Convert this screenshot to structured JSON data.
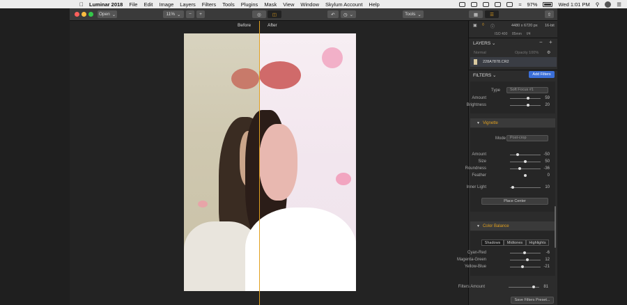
{
  "menubar": {
    "app": "Luminar 2018",
    "items": [
      "File",
      "Edit",
      "Image",
      "Layers",
      "Filters",
      "Tools",
      "Plugins",
      "Mask",
      "View",
      "Window",
      "Skylum Account",
      "Help"
    ],
    "battery": "97%",
    "clock": "Wed 1:01 PM"
  },
  "toolbar": {
    "open_label": "Open",
    "zoom_value": "11%",
    "zoom_out": "−",
    "zoom_in": "+",
    "tools_label": "Tools"
  },
  "canvas": {
    "before_label": "Before",
    "after_label": "After",
    "split_fraction": 0.437
  },
  "info": {
    "dimensions": "4480 x 6720 px",
    "bitdepth": "16-bit",
    "iso": "ISO 400",
    "focal": "85mm",
    "aperture": "f/4"
  },
  "layers": {
    "title": "LAYERS",
    "blend_mode": "Normal",
    "opacity": "Opacity 100%",
    "file_name": "228A7878.CR2"
  },
  "filters": {
    "title": "FILTERS",
    "add_button": "Add Filters",
    "soft_focus": {
      "type_label": "Type",
      "type_value": "Soft Focus #1",
      "sliders": [
        {
          "label": "Amount",
          "value": "59",
          "fraction": 0.59
        },
        {
          "label": "Brightness",
          "value": "20",
          "fraction": 0.6
        }
      ]
    },
    "vignette": {
      "title": "Vignette",
      "mode_label": "Mode",
      "mode_value": "Post-crop",
      "sliders": [
        {
          "label": "Amount",
          "value": "-50",
          "fraction": 0.25
        },
        {
          "label": "Size",
          "value": "50",
          "fraction": 0.5
        },
        {
          "label": "Roundness",
          "value": "-36",
          "fraction": 0.32
        },
        {
          "label": "Feather",
          "value": "0",
          "fraction": 0.5
        }
      ],
      "inner_light": {
        "label": "Inner Light",
        "value": "10",
        "fraction": 0.1
      },
      "place_center": "Place Center"
    },
    "color_balance": {
      "title": "Color Balance",
      "tabs": [
        "Shadows",
        "Midtones",
        "Highlights"
      ],
      "sliders": [
        {
          "label": "Cyan-Red",
          "value": "-6",
          "fraction": 0.47
        },
        {
          "label": "Magenta-Green",
          "value": "12",
          "fraction": 0.56
        },
        {
          "label": "Yellow-Blue",
          "value": "-21",
          "fraction": 0.4
        }
      ]
    },
    "filters_amount": {
      "label": "Filters Amount",
      "value": "81",
      "fraction": 0.81
    },
    "save_preset": "Save Filters Preset..."
  }
}
